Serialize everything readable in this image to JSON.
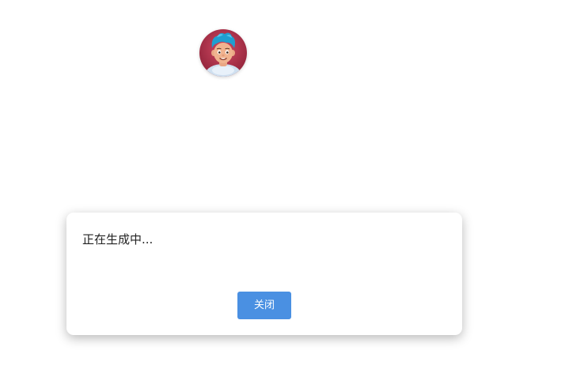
{
  "avatar": {
    "icon": "cartoon-boy-avatar",
    "background_color": "#b0324a",
    "hair_color": "#1f9fd0"
  },
  "modal": {
    "message": "正在生成中...",
    "close_label": "关闭",
    "close_button_color": "#4a90e2"
  }
}
